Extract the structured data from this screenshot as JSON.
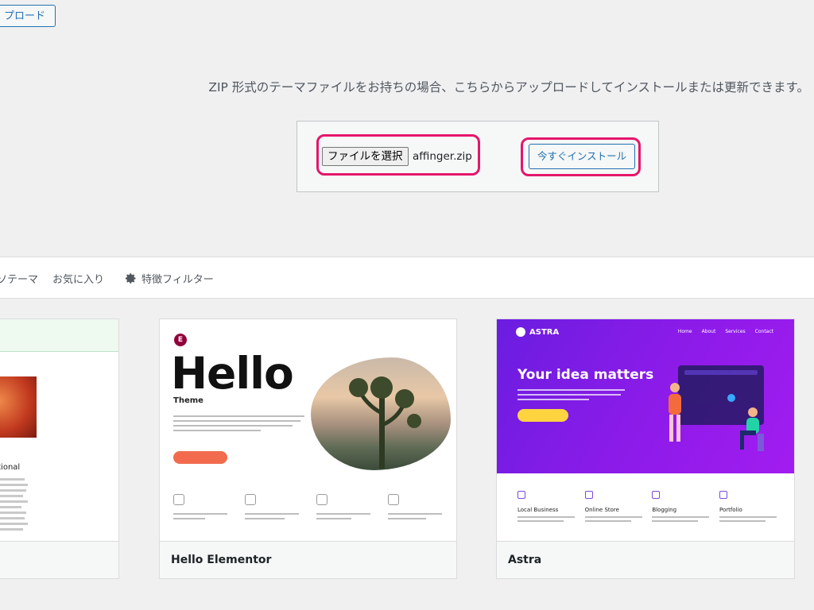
{
  "top": {
    "upload_button_partial": "プロード"
  },
  "upload": {
    "description": "ZIP 形式のテーマファイルをお持ちの場合、こちらからアップロードしてインストールまたは更新できます。",
    "choose_file_label": "ファイルを選択",
    "file_name": "affinger.zip",
    "install_label": "今すぐインストール",
    "highlight_color": "#e5166b"
  },
  "filters": {
    "popular_partial": "ソテーマ",
    "favorites": "お気に入り",
    "feature_filter": "特徴フィルター",
    "feature_icon": "gear-icon"
  },
  "themes": [
    {
      "name": "",
      "preview_caption": "ational"
    },
    {
      "name": "Hello Elementor",
      "preview_title": "Hello",
      "preview_subtitle": "Theme",
      "logo_letter": "E"
    },
    {
      "name": "Astra",
      "preview_logo": "ASTRA",
      "preview_headline": "Your idea matters",
      "preview_nav": [
        "Home",
        "About",
        "Services",
        "Contact"
      ],
      "preview_features": [
        "Local Business",
        "Online Store",
        "Blogging",
        "Portfolio"
      ],
      "accent": "#7b2ff7"
    }
  ],
  "colors": {
    "link": "#2271b1",
    "background": "#f0f0f1"
  }
}
